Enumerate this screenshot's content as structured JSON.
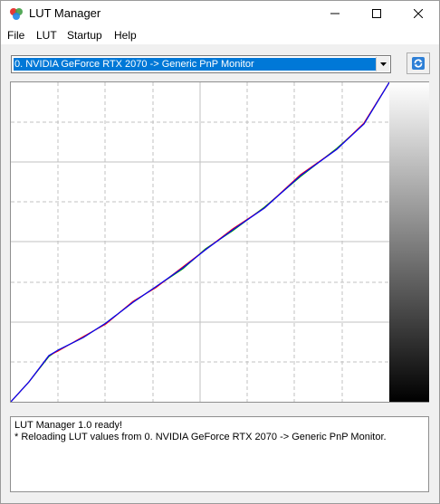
{
  "window": {
    "title": "LUT Manager",
    "icon": "lut-manager-app-icon",
    "controls": [
      "minimize-icon",
      "maximize-icon",
      "close-icon"
    ]
  },
  "menu": {
    "items": [
      "File",
      "LUT",
      "Startup",
      "Help"
    ]
  },
  "display_select": {
    "value": "0. NVIDIA GeForce RTX 2070 -> Generic PnP Monitor",
    "highlight_color": "#0078d7"
  },
  "reload_button": {
    "icon": "reload-icon"
  },
  "lut_graph": {
    "gradient": [
      "#ffffff",
      "#000000"
    ],
    "curve_colors": [
      "#ff0000",
      "#00aa00",
      "#0000ff"
    ],
    "grid": true
  },
  "log": {
    "lines": [
      "LUT Manager 1.0 ready!",
      "* Reloading LUT values from 0. NVIDIA GeForce RTX 2070 -> Generic PnP Monitor."
    ]
  }
}
